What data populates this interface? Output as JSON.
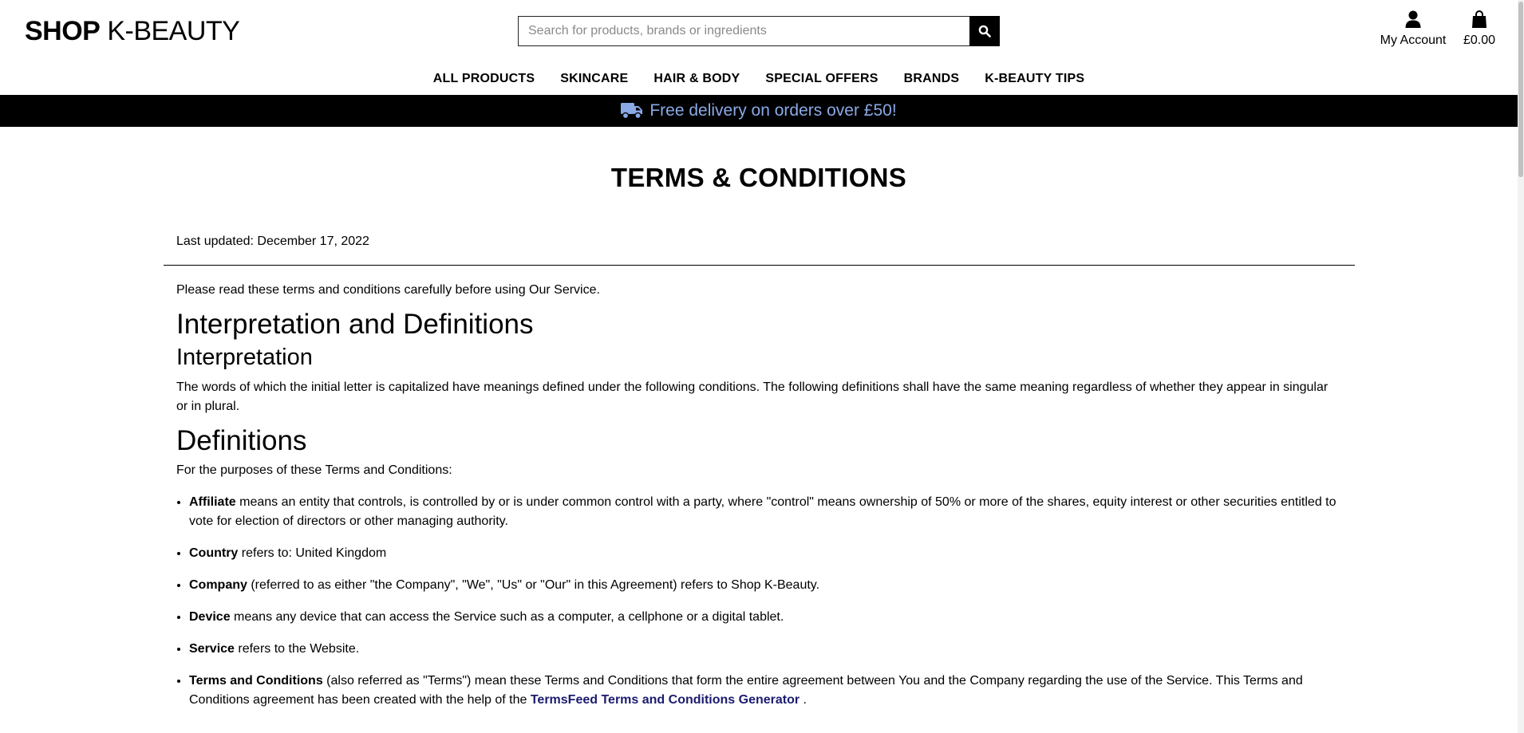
{
  "header": {
    "logo_bold": "SHOP",
    "logo_light": "K-BEAUTY",
    "search_placeholder": "Search for products, brands or ingredients",
    "search_icon": "search-icon",
    "account": {
      "icon": "user-icon",
      "label": "My Account"
    },
    "cart": {
      "icon": "shopping-bag-icon",
      "label": "£0.00"
    }
  },
  "nav": {
    "items": [
      {
        "label": "ALL PRODUCTS"
      },
      {
        "label": "SKINCARE"
      },
      {
        "label": "HAIR & BODY"
      },
      {
        "label": "SPECIAL OFFERS"
      },
      {
        "label": "BRANDS"
      },
      {
        "label": "K-BEAUTY TIPS"
      }
    ]
  },
  "banner": {
    "icon": "truck-icon",
    "text": "Free delivery on orders over £50!",
    "text_color": "#8aa9e6",
    "bg_color": "#000000"
  },
  "page": {
    "title": "TERMS & CONDITIONS",
    "last_updated": "Last updated: December 17, 2022",
    "intro": "Please read these terms and conditions carefully before using Our Service.",
    "h_interp_defs": "Interpretation and Definitions",
    "h_interpretation": "Interpretation",
    "interpretation_text": "The words of which the initial letter is capitalized have meanings defined under the following conditions. The following definitions shall have the same meaning regardless of whether they appear in singular or in plural.",
    "h_definitions": "Definitions",
    "definitions_lead": "For the purposes of these Terms and Conditions:",
    "definitions": [
      {
        "term": "Affiliate",
        "text": " means an entity that controls, is controlled by or is under common control with a party, where \"control\" means ownership of 50% or more of the shares, equity interest or other securities entitled to vote for election of directors or other managing authority."
      },
      {
        "term": "Country",
        "text": " refers to: United Kingdom"
      },
      {
        "term": "Company",
        "text": " (referred to as either \"the Company\", \"We\", \"Us\" or \"Our\" in this Agreement) refers to Shop K-Beauty."
      },
      {
        "term": "Device",
        "text": " means any device that can access the Service such as a computer, a cellphone or a digital tablet."
      },
      {
        "term": "Service",
        "text": " refers to the Website."
      },
      {
        "term": "Terms and Conditions",
        "text": " (also referred as \"Terms\") mean these Terms and Conditions that form the entire agreement between You and the Company regarding the use of the Service. This Terms and Conditions agreement has been created with the help of the ",
        "link": "TermsFeed Terms and Conditions Generator",
        "after": " ."
      }
    ]
  }
}
